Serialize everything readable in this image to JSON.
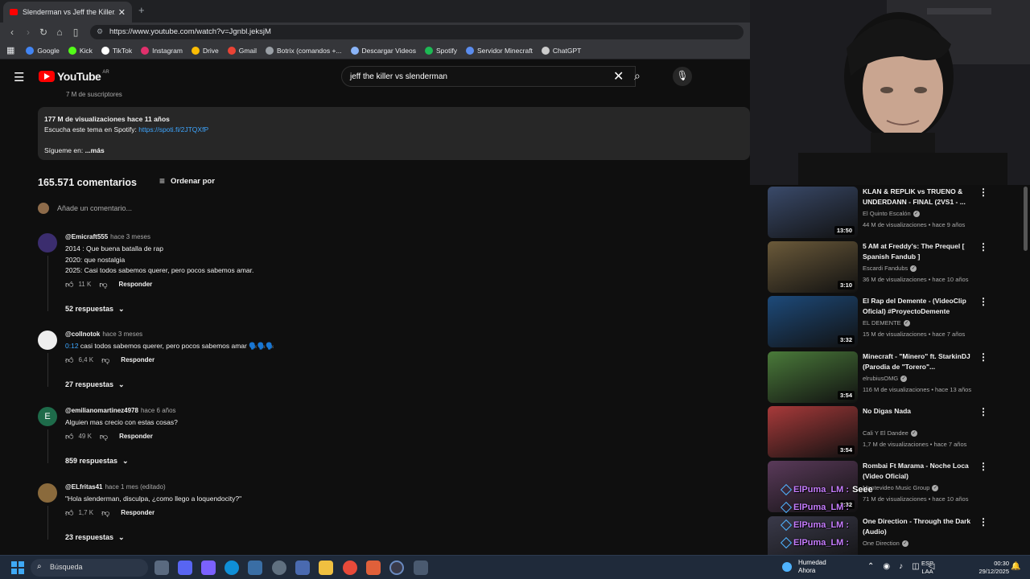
{
  "browser": {
    "tab_title": "Slenderman vs Jeff the Killer. Ba",
    "tab_close": "✕",
    "new_tab": "+",
    "url": "https://www.youtube.com/watch?v=Jgnbl.jeksjM",
    "bookmarks": [
      {
        "label": "Google",
        "color": "#4285f4"
      },
      {
        "label": "Kick",
        "color": "#53fc18"
      },
      {
        "label": "TikTok",
        "color": "#ffffff"
      },
      {
        "label": "Instagram",
        "color": "#e1306c"
      },
      {
        "label": "Drive",
        "color": "#fbbc04"
      },
      {
        "label": "Gmail",
        "color": "#ea4335"
      },
      {
        "label": "Botrix (comandos +...",
        "color": "#9aa0a6"
      },
      {
        "label": "Descargar Videos",
        "color": "#8ab4f8"
      },
      {
        "label": "Spotify",
        "color": "#1db954"
      },
      {
        "label": "Servidor Minecraft",
        "color": "#5b8def"
      },
      {
        "label": "ChatGPT",
        "color": "#cccccc"
      }
    ]
  },
  "youtube": {
    "logo_text": "YouTube",
    "logo_country": "AR",
    "search_value": "jeff the killer vs slenderman",
    "subscribers": "7 M de suscriptores",
    "description": {
      "views_line": "177 M de visualizaciones  hace 11 años",
      "spotify_prefix": "Escucha este tema en Spotify: ",
      "spotify_link": "https://spoti.fi/2JTQXfP",
      "follow": "Sígueme en:",
      "more": "...más"
    },
    "comments_count": "165.571 comentarios",
    "sort_label": "Ordenar por",
    "add_comment_placeholder": "Añade un comentario...",
    "comments": [
      {
        "user": "@Emicraft555",
        "time": "hace 3 meses",
        "lines": [
          "2014 : Que buena batalla de rap",
          "2020: que nostalgia",
          "2025: Casi todos sabemos querer, pero pocos sabemos amar."
        ],
        "likes": "11 K",
        "reply": "Responder",
        "replies": "52 respuestas",
        "avatar_color": "#3b2d6e"
      },
      {
        "user": "@collnotok",
        "time": "hace 3 meses",
        "timestamp": "0:12",
        "lines": [
          " casi todos sabemos querer, pero pocos sabemos amar 🗣️🗣️🗣️"
        ],
        "likes": "6,4 K",
        "reply": "Responder",
        "replies": "27 respuestas",
        "avatar_color": "#eeeeee"
      },
      {
        "user": "@emilianomartinez4978",
        "time": "hace 6 años",
        "lines": [
          "Alguien mas crecio con estas cosas?"
        ],
        "likes": "49 K",
        "reply": "Responder",
        "replies": "859 respuestas",
        "avatar_color": "#1e6b4a",
        "avatar_letter": "E"
      },
      {
        "user": "@ELfritas41",
        "time": "hace 1 mes (editado)",
        "lines": [
          "\"Hola slenderman, disculpa, ¿como llego a loquendocity?\""
        ],
        "likes": "1,7 K",
        "reply": "Responder",
        "replies": "23 respuestas",
        "avatar_color": "#8a6a3c"
      }
    ],
    "recommendations": [
      {
        "title": "KLAN & REPLIK vs TRUENO & UNDERDANN - FINAL (2VS1 - ...",
        "channel": "El Quinto Escalón",
        "stats": "44 M de visualizaciones • hace 9 años",
        "duration": "13:50",
        "thumb_color": "#3a4a6a"
      },
      {
        "title": "5 AM at Freddy's: The Prequel [ Spanish Fandub ]",
        "channel": "Escardi Fandubs",
        "stats": "36 M de visualizaciones • hace 10 años",
        "duration": "3:10",
        "thumb_color": "#6b5a3a"
      },
      {
        "title": "El Rap del Demente - (VideoClip Oficial) #ProyectoDemente",
        "channel": "EL DEMENTE",
        "stats": "15 M de visualizaciones • hace 7 años",
        "duration": "3:32",
        "thumb_color": "#1d4a7a"
      },
      {
        "title": "Minecraft - \"Minero\" ft. StarkinDJ (Parodia de \"Torero\"...",
        "channel": "elrubiusOMG",
        "stats": "116 M de visualizaciones • hace 13 años",
        "duration": "3:54",
        "thumb_color": "#4a7a3a"
      },
      {
        "title": "No Digas Nada",
        "channel": "Cali Y El Dandee",
        "stats": "1,7 M de visualizaciones • hace 7 años",
        "duration": "3:54",
        "thumb_color": "#a83a3a"
      },
      {
        "title": "Rombai Ft Marama - Noche Loca (Video Oficial)",
        "channel": "Montevideo Music Group",
        "stats": "71 M de visualizaciones • hace 10 años",
        "duration": "3:32",
        "thumb_color": "#5a3a5a"
      },
      {
        "title": "One Direction - Through the Dark (Audio)",
        "channel": "One Direction",
        "stats": "",
        "duration": "",
        "thumb_color": "#3a3a4a"
      }
    ]
  },
  "chat": [
    {
      "user": "ElPuma_LM :",
      "msg": "Seee"
    },
    {
      "user": "ElPuma_LM :",
      "msg": ""
    },
    {
      "user": "ElPuma_LM :",
      "msg": ""
    },
    {
      "user": "ElPuma_LM :",
      "msg": ""
    }
  ],
  "taskbar": {
    "search_label": "Búsqueda",
    "weather_title": "Humedad",
    "weather_sub": "Ahora",
    "lang_top": "ESP",
    "lang_bottom": "LAA",
    "time": "00:30",
    "date": "29/12/2025"
  }
}
